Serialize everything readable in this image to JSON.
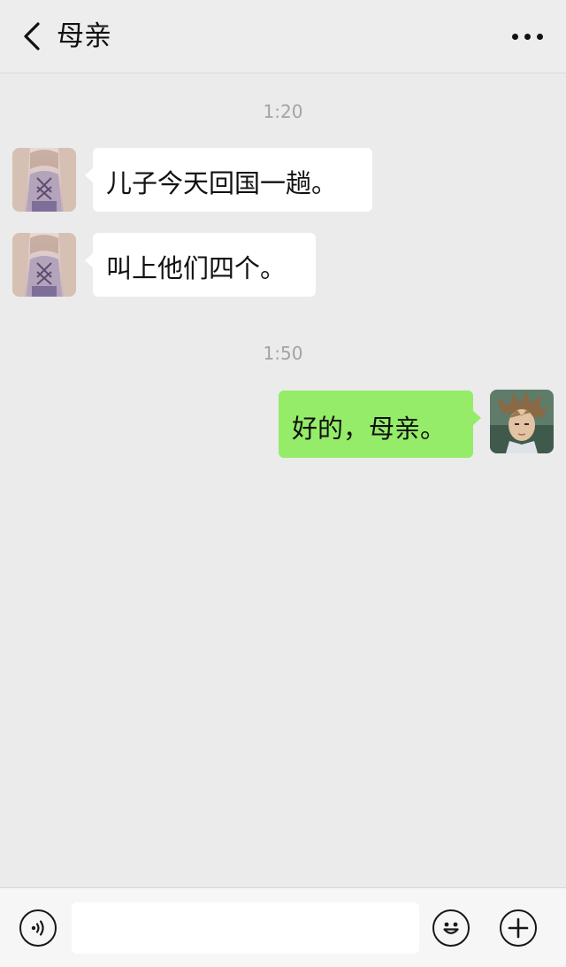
{
  "header": {
    "title": "母亲"
  },
  "messages": [
    {
      "time": "1:20",
      "text": "儿子今天回国一趟。",
      "sender": "contact"
    },
    {
      "text": "叫上他们四个。",
      "sender": "contact"
    },
    {
      "time": "1:50",
      "text": "好的，母亲。",
      "sender": "me"
    }
  ],
  "input": {
    "value": ""
  },
  "icons": {
    "back": "chevron-left-icon",
    "more": "more-dots-icon",
    "voice": "voice-icon",
    "emoji": "emoji-icon",
    "add": "plus-icon"
  },
  "colors": {
    "background": "#ebebeb",
    "incoming_bubble": "#ffffff",
    "outgoing_bubble": "#95ec69",
    "timestamp": "#a3a3a3"
  }
}
